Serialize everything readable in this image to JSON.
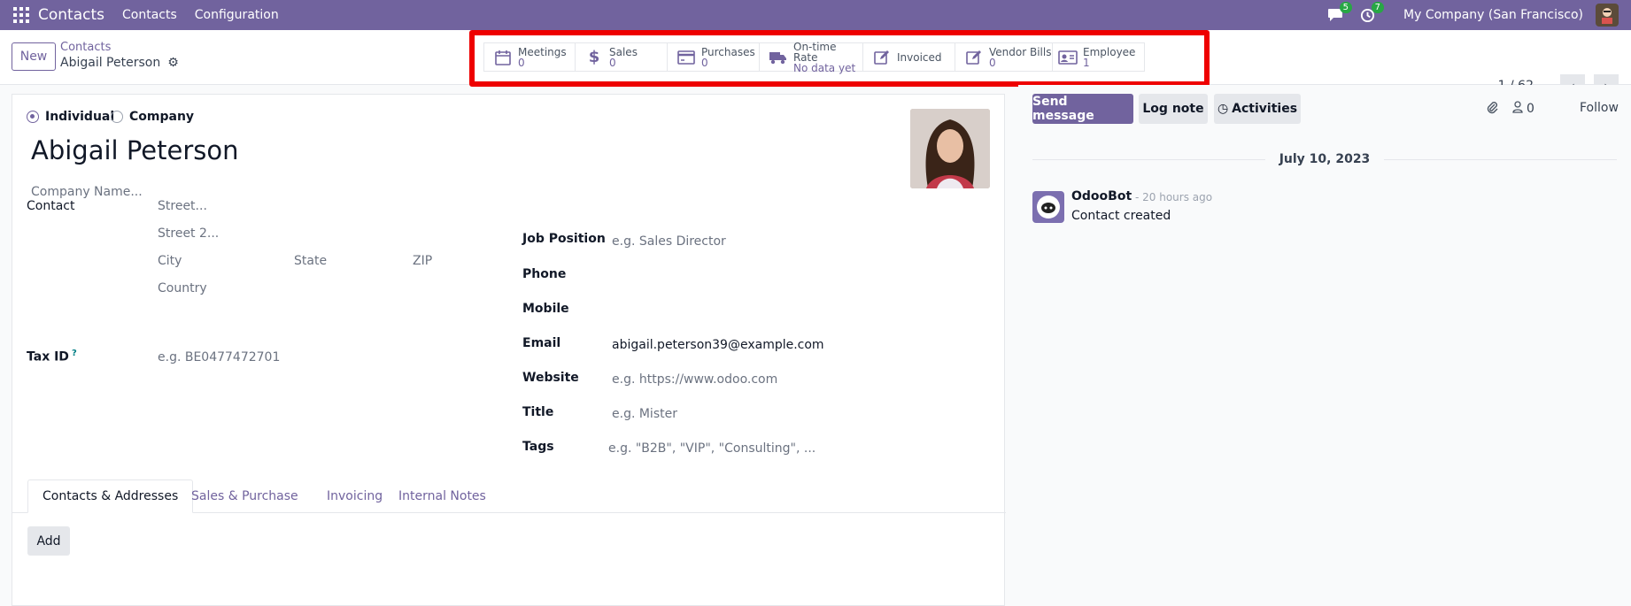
{
  "navbar": {
    "brand": "Contacts",
    "menus": [
      "Contacts",
      "Configuration"
    ],
    "messages_count": "5",
    "activities_count": "7",
    "company": "My Company (San Francisco)"
  },
  "control": {
    "new_label": "New",
    "breadcrumb_parent": "Contacts",
    "breadcrumb_current": "Abigail Peterson",
    "pager": "1 / 62"
  },
  "stats": [
    {
      "label": "Meetings",
      "value": "0",
      "icon": "calendar-icon"
    },
    {
      "label": "Sales",
      "value": "0",
      "icon": "dollar-icon"
    },
    {
      "label": "Purchases",
      "value": "0",
      "icon": "credit-card-icon"
    },
    {
      "label": "On-time Rate",
      "value": "No data yet",
      "icon": "truck-icon"
    },
    {
      "label": "Invoiced",
      "value": "",
      "icon": "edit-icon"
    },
    {
      "label": "Vendor Bills",
      "value": "0",
      "icon": "edit-icon"
    },
    {
      "label": "Employee",
      "value": "1",
      "icon": "id-card-icon"
    }
  ],
  "form": {
    "type_individual": "Individual",
    "type_company": "Company",
    "name": "Abigail Peterson",
    "company_placeholder": "Company Name...",
    "contact_label": "Contact",
    "street_placeholder": "Street...",
    "street2_placeholder": "Street 2...",
    "city_placeholder": "City",
    "state_placeholder": "State",
    "zip_placeholder": "ZIP",
    "country_placeholder": "Country",
    "taxid_label": "Tax ID",
    "taxid_help": "?",
    "taxid_placeholder": "e.g. BE0477472701",
    "job_label": "Job Position",
    "job_placeholder": "e.g. Sales Director",
    "phone_label": "Phone",
    "mobile_label": "Mobile",
    "email_label": "Email",
    "email_value": "abigail.peterson39@example.com",
    "website_label": "Website",
    "website_placeholder": "e.g. https://www.odoo.com",
    "title_label": "Title",
    "title_placeholder": "e.g. Mister",
    "tags_label": "Tags",
    "tags_placeholder": "e.g. \"B2B\", \"VIP\", \"Consulting\", ..."
  },
  "tabs": [
    "Contacts & Addresses",
    "Sales & Purchase",
    "Invoicing",
    "Internal Notes"
  ],
  "add_label": "Add",
  "chatter": {
    "send_message": "Send message",
    "log_note": "Log note",
    "activities": "Activities",
    "followers_count": "0",
    "follow": "Follow",
    "date": "July 10, 2023",
    "author": "OdooBot",
    "time": "- 20 hours ago",
    "body": "Contact created"
  },
  "colors": {
    "brand": "#71639e",
    "badge": "#28a745",
    "highlight": "#ee0000"
  }
}
